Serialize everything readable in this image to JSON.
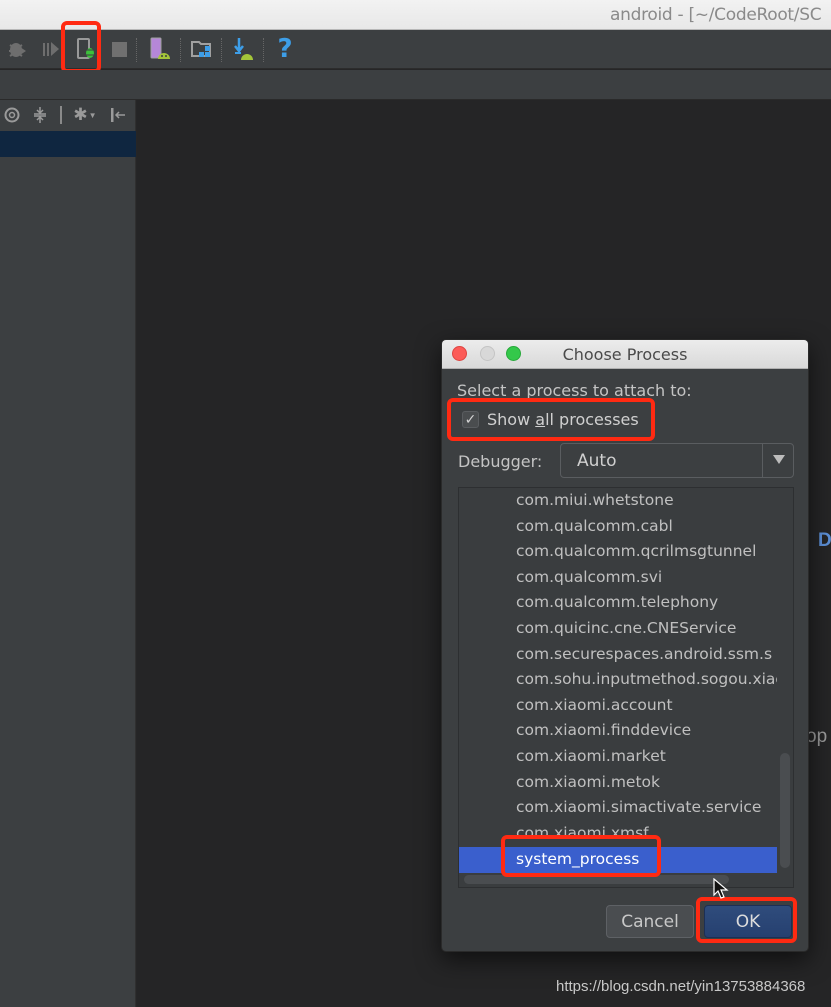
{
  "window": {
    "title": "android - [~/CodeRoot/SC"
  },
  "toolbar": {
    "icons": [
      {
        "name": "debug-icon",
        "label": "Debug"
      },
      {
        "name": "resume-icon",
        "label": "Resume"
      },
      {
        "name": "attach-debugger-icon",
        "label": "Attach debugger to Android process"
      },
      {
        "name": "stop-icon",
        "label": "Stop"
      },
      {
        "name": "avd-manager-icon",
        "label": "AVD Manager"
      },
      {
        "name": "project-structure-icon",
        "label": "Project Structure"
      },
      {
        "name": "sdk-manager-icon",
        "label": "SDK Manager"
      },
      {
        "name": "help-icon",
        "label": "?"
      }
    ]
  },
  "left_panel": {
    "toolbar_icons": [
      "target-icon",
      "collapse-icon",
      "gear-icon",
      "hide-icon"
    ]
  },
  "editor": {
    "edge_text_1": "D",
    "edge_text_2": "op"
  },
  "dialog": {
    "title": "Choose Process",
    "prompt": "Select a process to attach to:",
    "show_all": {
      "label_before": "Show ",
      "label_mnemonic": "a",
      "label_after": "ll processes",
      "checked": true
    },
    "debugger": {
      "label": "Debugger:",
      "value": "Auto"
    },
    "processes": [
      "com.miui.whetstone",
      "com.qualcomm.cabl",
      "com.qualcomm.qcrilmsgtunnel",
      "com.qualcomm.svi",
      "com.qualcomm.telephony",
      "com.quicinc.cne.CNEService",
      "com.securespaces.android.ssm.s",
      "com.sohu.inputmethod.sogou.xiao",
      "com.xiaomi.account",
      "com.xiaomi.finddevice",
      "com.xiaomi.market",
      "com.xiaomi.metok",
      "com.xiaomi.simactivate.service",
      "com.xiaomi.xmsf",
      "system_process"
    ],
    "selected_process": "system_process",
    "buttons": {
      "cancel": "Cancel",
      "ok": "OK"
    }
  },
  "colors": {
    "highlight": "#ff2a12",
    "selection": "#3a5fcd",
    "ok_button": "#2b4677"
  },
  "watermark": "https://blog.csdn.net/yin13753884368"
}
